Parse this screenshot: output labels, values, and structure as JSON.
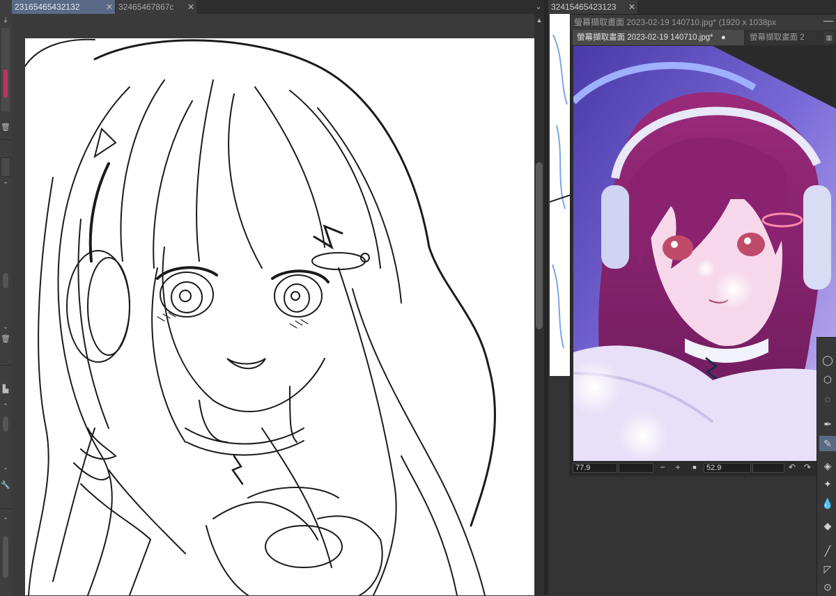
{
  "main_window": {
    "tabs": [
      {
        "label": "23165465432132",
        "close": "✕"
      },
      {
        "label": "32465467867c",
        "close": "✕"
      }
    ],
    "overflow": "⌄"
  },
  "right_window": {
    "tab": {
      "label": "32415465423123",
      "close": "✕"
    }
  },
  "sub_window": {
    "title": "螢幕擷取畫面 2023-02-19 140710.jpg* (1920 x 1038px",
    "minimize": "—",
    "tabs": [
      {
        "label": "螢幕擷取畫面 2023-02-19 140710.jpg*",
        "dot": "●"
      },
      {
        "label": "螢幕擷取畫面 2"
      }
    ],
    "status": {
      "zoom": "77.9",
      "minus": "−",
      "plus": "+",
      "fit": "■",
      "angle": "52.9",
      "rotate_left": "↶",
      "rotate_right": "↷"
    }
  },
  "left_strip": {
    "icons": [
      "save-icon",
      "trash-icon",
      "chevron-up-icon",
      "trash-icon",
      "lock-icon",
      "wrench-icon"
    ]
  },
  "right_palette": {
    "icons": [
      "circle-tool-icon",
      "cube-icon",
      "lasso-icon",
      "pen-icon",
      "brush-icon",
      "eraser-icon",
      "sparkle-icon",
      "drop-icon",
      "fill-icon",
      "line-icon",
      "frame-icon",
      "shape-icon"
    ]
  },
  "colors": {
    "active_tab": "#5a6a86",
    "canvas": "#ffffff",
    "panel": "#3a3a3a"
  }
}
